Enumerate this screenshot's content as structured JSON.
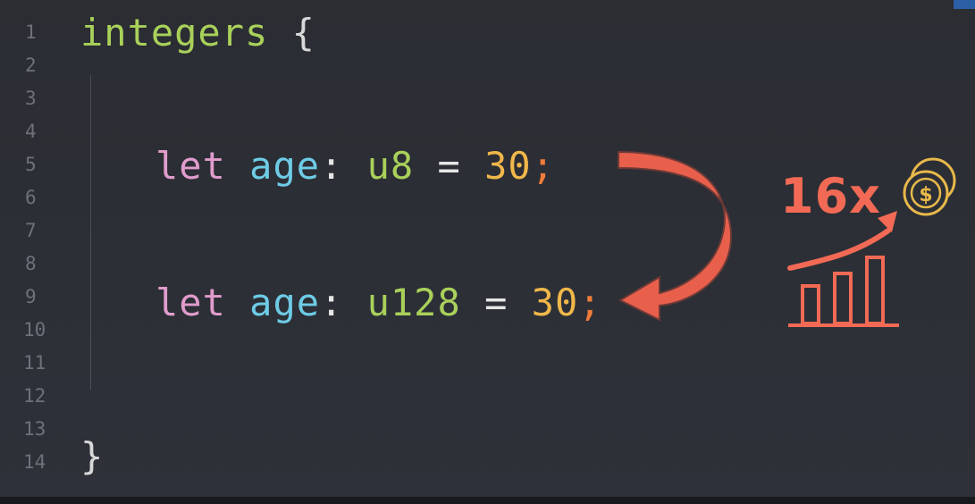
{
  "editor": {
    "line_numbers": [
      "1",
      "2",
      "3",
      "4",
      "5",
      "6",
      "7",
      "8",
      "9",
      "10",
      "11",
      "12",
      "13",
      "14"
    ],
    "line1": {
      "name": "integers",
      "brace": "{"
    },
    "line5": {
      "kw": "let",
      "ident": "age",
      "colon": ":",
      "type": "u8",
      "eq": "=",
      "value": "30",
      "semi": ";"
    },
    "line9": {
      "kw": "let",
      "ident": "age",
      "colon": ":",
      "type": "u128",
      "eq": "=",
      "value": "30",
      "semi": ";"
    },
    "line14": {
      "brace": "}"
    }
  },
  "overlay": {
    "multiplier_label": "16x",
    "arrow_icon": "curved-arrow-icon",
    "growth_icon": "growth-chart-coins-icon",
    "coin_symbol": "$",
    "accent_color": "#f26a55"
  }
}
